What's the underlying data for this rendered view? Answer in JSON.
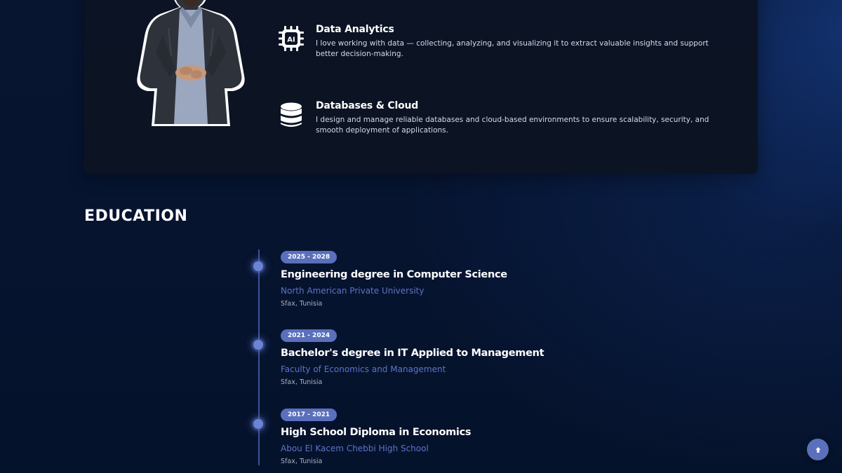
{
  "about": {
    "portrait_icon": "person-photo",
    "services": [
      {
        "icon": "ai-chip-icon",
        "title": "Data Analytics",
        "description": "I love working with data — collecting, analyzing, and visualizing it to extract valuable insights and support better decision-making."
      },
      {
        "icon": "database-icon",
        "title": "Databases & Cloud",
        "description": "I design and manage reliable databases and cloud-based environments to ensure scalability, security, and smooth deployment of applications."
      }
    ]
  },
  "education": {
    "title": "EDUCATION",
    "items": [
      {
        "years": "2025 - 2028",
        "degree": "Engineering degree in Computer Science",
        "school": "North American Private University",
        "location": "Sfax, Tunisia"
      },
      {
        "years": "2021 - 2024",
        "degree": "Bachelor's degree in IT Applied to Management",
        "school": "Faculty of Economics and Management",
        "location": "Sfax, Tunisia"
      },
      {
        "years": "2017 - 2021",
        "degree": "High School Diploma in Economics",
        "school": "Abou El Kacem Chebbi High School",
        "location": "Sfax, Tunisia"
      }
    ]
  },
  "back_to_top": {
    "icon": "arrow-up-icon"
  },
  "colors": {
    "accent": "#5a70bd",
    "school_text": "#5b74c8",
    "page_background": "#061430",
    "card_background": "#0b1324"
  }
}
